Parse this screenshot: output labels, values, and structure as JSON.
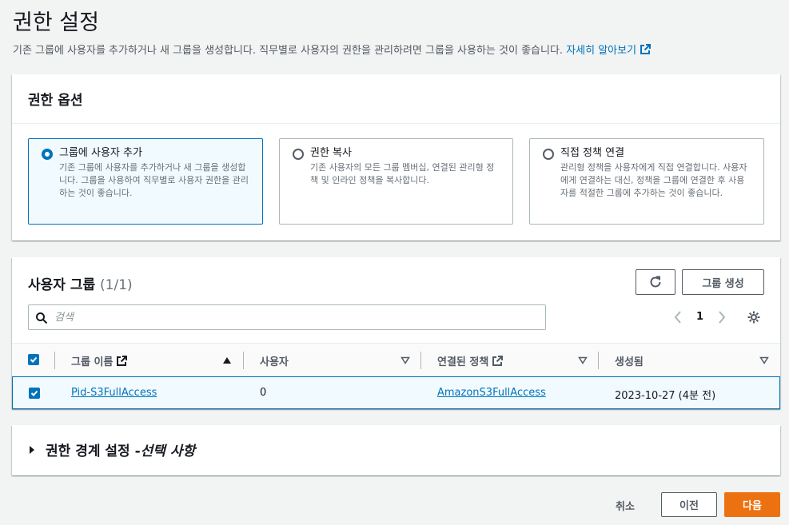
{
  "page": {
    "title": "권한 설정",
    "description": "기존 그룹에 사용자를 추가하거나 새 그룹을 생성합니다. 직무별로 사용자의 권한을 관리하려면 그룹을 사용하는 것이 좋습니다.",
    "learn_more": "자세히 알아보기"
  },
  "options": {
    "header": "권한 옵션",
    "items": [
      {
        "title": "그룹에 사용자 추가",
        "desc": "기존 그룹에 사용자를 추가하거나 새 그룹을 생성합니다. 그룹을 사용하여 직무별로 사용자 권한을 관리하는 것이 좋습니다.",
        "selected": true
      },
      {
        "title": "권한 복사",
        "desc": "기존 사용자의 모든 그룹 멤버십, 연결된 관리형 정책 및 인라인 정책을 복사합니다.",
        "selected": false
      },
      {
        "title": "직접 정책 연결",
        "desc": "관리형 정책을 사용자에게 직접 연결합니다. 사용자에게 연결하는 대신, 정책을 그룹에 연결한 후 사용자를 적절한 그룹에 추가하는 것이 좋습니다.",
        "selected": false
      }
    ]
  },
  "groups": {
    "title": "사용자 그룹",
    "count": "(1/1)",
    "create_button": "그룹 생성",
    "search_placeholder": "검색",
    "page_number": "1",
    "columns": [
      "그룹 이름",
      "사용자",
      "연결된 정책",
      "생성됨"
    ],
    "rows": [
      {
        "name": "Pid-S3FullAccess",
        "users": "0",
        "policy": "AmazonS3FullAccess",
        "created": "2023-10-27 (4분 전)",
        "checked": true
      }
    ]
  },
  "boundary": {
    "title": "권한 경계 설정 - ",
    "title_optional": "선택 사항"
  },
  "footer": {
    "cancel": "취소",
    "previous": "이전",
    "next": "다음"
  },
  "colors": {
    "primary": "#0073bb",
    "accent": "#ec7211",
    "selected_bg": "#f1faff"
  }
}
